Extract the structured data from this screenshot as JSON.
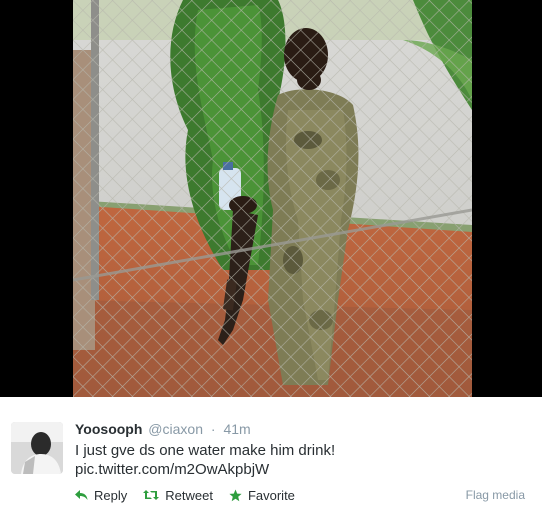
{
  "tweet": {
    "display_name": "Yoosooph",
    "handle": "@ciaxon",
    "separator": "·",
    "timestamp": "41m",
    "text": "I just gve ds one water make him drink!",
    "media_link": "pic.twitter.com/m2OwAkpbjW"
  },
  "actions": {
    "reply_label": "Reply",
    "retweet_label": "Retweet",
    "favorite_label": "Favorite",
    "flag_label": "Flag media"
  },
  "icons": {
    "reply": "reply-icon",
    "retweet": "retweet-icon",
    "favorite": "star-icon"
  },
  "colors": {
    "action_green": "#2e9e3e",
    "name_text": "#292f33",
    "muted_text": "#8899a6",
    "media_background": "#000000"
  }
}
